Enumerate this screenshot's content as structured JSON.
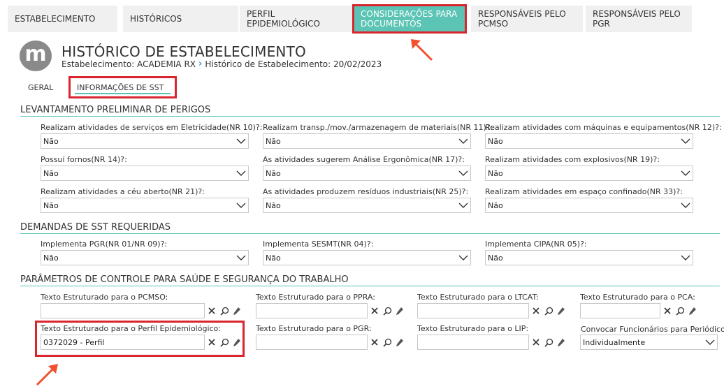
{
  "top_tabs": [
    {
      "line1": "ESTABELECIMENTO",
      "line2": ""
    },
    {
      "line1": "HISTÓRICOS",
      "line2": ""
    },
    {
      "line1": "PERFIL",
      "line2": "EPIDEMIOLÓGICO"
    },
    {
      "line1": "CONSIDERAÇÕES PARA",
      "line2": "DOCUMENTOS"
    },
    {
      "line1": "RESPONSÁVEIS PELO",
      "line2": "PCMSO"
    },
    {
      "line1": "RESPONSÁVEIS PELO",
      "line2": "PGR"
    }
  ],
  "header": {
    "logo_letter": "m",
    "title": "HISTÓRICO DE ESTABELECIMENTO",
    "breadcrumb_1": "Estabelecimento: ACADEMIA RX",
    "breadcrumb_sep": "›",
    "breadcrumb_2": "Histórico de Estabelecimento: 20/02/2023"
  },
  "sub_tabs": {
    "geral": "GERAL",
    "sst": "INFORMAÇÕES DE SST"
  },
  "sections": {
    "s1": "LEVANTAMENTO PRELIMINAR DE PERIGOS",
    "s2": "DEMANDAS DE SST REQUERIDAS",
    "s3": "PARÂMETROS DE CONTROLE PARA SAÚDE E SEGURANÇA DO TRABALHO"
  },
  "perigos": [
    {
      "label": "Realizam atividades de serviços em Eletricidade(NR 10)?:",
      "value": "Não"
    },
    {
      "label": "Realizam transp./mov./armazenagem de materiais(NR 11)?:",
      "value": "Não"
    },
    {
      "label": "Realizam atividades com máquinas e equipamentos(NR 12)?:",
      "value": "Não"
    },
    {
      "label": "Possuí fornos(NR 14)?:",
      "value": "Não"
    },
    {
      "label": "As atividades sugerem Análise Ergonômica(NR 17)?:",
      "value": "Não"
    },
    {
      "label": "Realizam atividades com explosivos(NR 19)?:",
      "value": "Não"
    },
    {
      "label": "Realizam atividades a céu aberto(NR 21)?:",
      "value": "Não"
    },
    {
      "label": "As atividades produzem resíduos industriais(NR 25)?:",
      "value": "Não"
    },
    {
      "label": "Realizam atividades em espaço confinado(NR 33)?:",
      "value": "Não"
    }
  ],
  "demandas": [
    {
      "label": "Implementa PGR(NR 01/NR 09)?:",
      "value": "Não"
    },
    {
      "label": "Implementa SESMT(NR 04)?:",
      "value": "Não"
    },
    {
      "label": "Implementa CIPA(NR 05)?:",
      "value": "Não"
    }
  ],
  "parametros": [
    {
      "label": "Texto Estruturado para o PCMSO:",
      "value": ""
    },
    {
      "label": "Texto Estruturado para o PPRA:",
      "value": ""
    },
    {
      "label": "Texto Estruturado para o LTCAT:",
      "value": ""
    },
    {
      "label": "Texto Estruturado para o PCA:",
      "value": ""
    },
    {
      "label": "Texto Estruturado para o Perfil Epidemiológico:",
      "value": "0372029 - Perfil"
    },
    {
      "label": "Texto Estruturado para o PGR:",
      "value": ""
    },
    {
      "label": "Texto Estruturado para o LIP:",
      "value": ""
    }
  ],
  "convocar": {
    "label": "Convocar Funcionários para Periódicos:",
    "required_mark": "*",
    "value": "Individualmente"
  },
  "colors": {
    "accent": "#5bc4b4",
    "highlight": "#d9252e",
    "arrow": "#f0502e"
  },
  "icons": {
    "clear": "clear-icon",
    "search": "search-icon",
    "edit": "edit-icon",
    "dropdown": "chevron-down-icon"
  }
}
